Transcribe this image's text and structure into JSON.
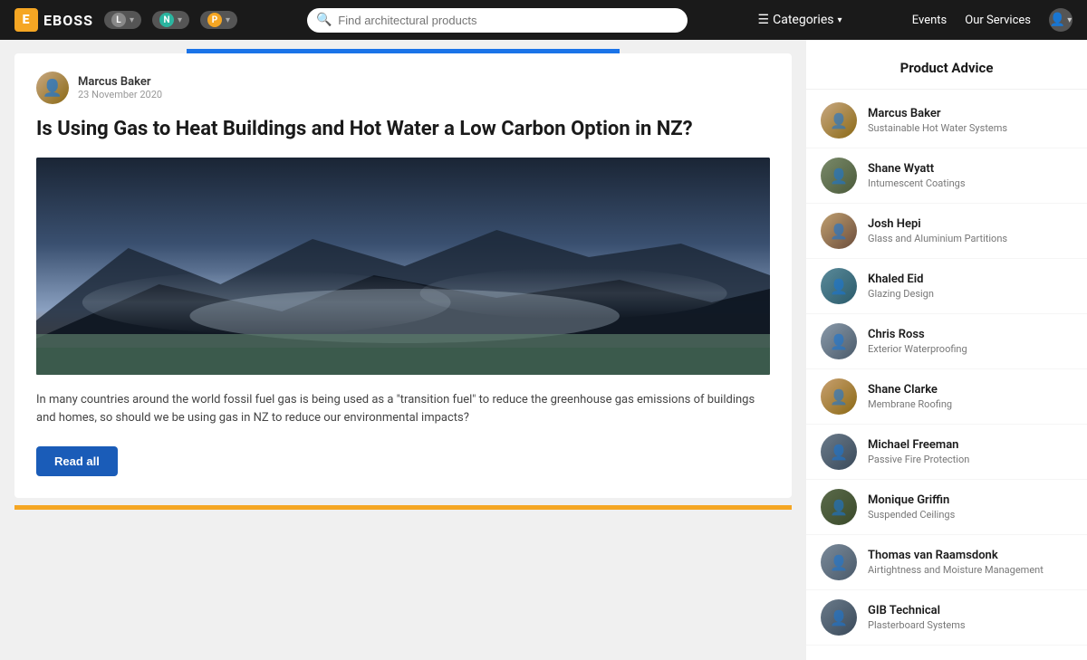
{
  "header": {
    "logo_letter": "E",
    "logo_text": "EBOSS",
    "badge1_letter": "L",
    "badge2_letter": "N",
    "badge3_letter": "P",
    "search_placeholder": "Find architectural products",
    "categories_label": "Categories",
    "events_label": "Events",
    "services_label": "Our Services"
  },
  "article": {
    "author_name": "Marcus Baker",
    "author_date": "23 November 2020",
    "title": "Is Using Gas to Heat Buildings and Hot Water a Low Carbon Option in NZ?",
    "body": "In many countries around the world fossil fuel gas is being used as a \"transition fuel\" to reduce the greenhouse gas emissions of buildings and homes, so should we be using gas in NZ to reduce our environmental impacts?",
    "read_all_label": "Read all"
  },
  "sidebar": {
    "title": "Product Advice",
    "advisors": [
      {
        "name": "Marcus Baker",
        "specialty": "Sustainable Hot Water Systems",
        "av": "av-1"
      },
      {
        "name": "Shane Wyatt",
        "specialty": "Intumescent Coatings",
        "av": "av-2"
      },
      {
        "name": "Josh Hepi",
        "specialty": "Glass and Aluminium Partitions",
        "av": "av-3"
      },
      {
        "name": "Khaled Eid",
        "specialty": "Glazing Design",
        "av": "av-4"
      },
      {
        "name": "Chris Ross",
        "specialty": "Exterior Waterproofing",
        "av": "av-5"
      },
      {
        "name": "Shane Clarke",
        "specialty": "Membrane Roofing",
        "av": "av-6"
      },
      {
        "name": "Michael Freeman",
        "specialty": "Passive Fire Protection",
        "av": "av-7"
      },
      {
        "name": "Monique Griffin",
        "specialty": "Suspended Ceilings",
        "av": "av-8"
      },
      {
        "name": "Thomas van Raamsdonk",
        "specialty": "Airtightness and Moisture Management",
        "av": "av-9"
      },
      {
        "name": "GIB Technical",
        "specialty": "Plasterboard Systems",
        "av": "av-10"
      }
    ]
  }
}
